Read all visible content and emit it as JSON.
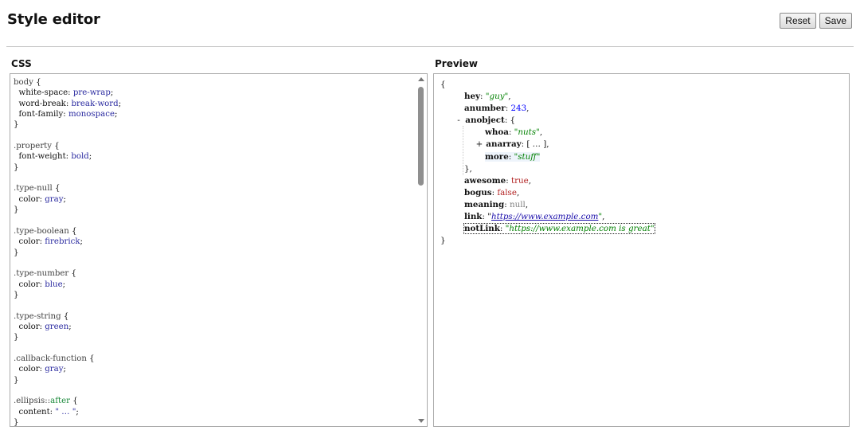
{
  "header": {
    "title": "Style editor",
    "reset_label": "Reset",
    "save_label": "Save"
  },
  "css_panel": {
    "label": "CSS",
    "lines": [
      [
        [
          "sel",
          "body"
        ],
        [
          "plain",
          " {"
        ]
      ],
      [
        [
          "plain",
          "  "
        ],
        [
          "prop",
          "white-space"
        ],
        [
          "plain",
          ": "
        ],
        [
          "val",
          "pre-wrap"
        ],
        [
          "plain",
          ";"
        ]
      ],
      [
        [
          "plain",
          "  "
        ],
        [
          "prop",
          "word-break"
        ],
        [
          "plain",
          ": "
        ],
        [
          "val",
          "break-word"
        ],
        [
          "plain",
          ";"
        ]
      ],
      [
        [
          "plain",
          "  "
        ],
        [
          "prop",
          "font-family"
        ],
        [
          "plain",
          ": "
        ],
        [
          "val",
          "monospace"
        ],
        [
          "plain",
          ";"
        ]
      ],
      [
        [
          "plain",
          "}"
        ]
      ],
      [
        [
          "plain",
          ""
        ]
      ],
      [
        [
          "sel",
          ".property"
        ],
        [
          "plain",
          " {"
        ]
      ],
      [
        [
          "plain",
          "  "
        ],
        [
          "prop",
          "font-weight"
        ],
        [
          "plain",
          ": "
        ],
        [
          "val",
          "bold"
        ],
        [
          "plain",
          ";"
        ]
      ],
      [
        [
          "plain",
          "}"
        ]
      ],
      [
        [
          "plain",
          ""
        ]
      ],
      [
        [
          "sel",
          ".type-null"
        ],
        [
          "plain",
          " {"
        ]
      ],
      [
        [
          "plain",
          "  "
        ],
        [
          "prop",
          "color"
        ],
        [
          "plain",
          ": "
        ],
        [
          "val",
          "gray"
        ],
        [
          "plain",
          ";"
        ]
      ],
      [
        [
          "plain",
          "}"
        ]
      ],
      [
        [
          "plain",
          ""
        ]
      ],
      [
        [
          "sel",
          ".type-boolean"
        ],
        [
          "plain",
          " {"
        ]
      ],
      [
        [
          "plain",
          "  "
        ],
        [
          "prop",
          "color"
        ],
        [
          "plain",
          ": "
        ],
        [
          "val",
          "firebrick"
        ],
        [
          "plain",
          ";"
        ]
      ],
      [
        [
          "plain",
          "}"
        ]
      ],
      [
        [
          "plain",
          ""
        ]
      ],
      [
        [
          "sel",
          ".type-number"
        ],
        [
          "plain",
          " {"
        ]
      ],
      [
        [
          "plain",
          "  "
        ],
        [
          "prop",
          "color"
        ],
        [
          "plain",
          ": "
        ],
        [
          "val",
          "blue"
        ],
        [
          "plain",
          ";"
        ]
      ],
      [
        [
          "plain",
          "}"
        ]
      ],
      [
        [
          "plain",
          ""
        ]
      ],
      [
        [
          "sel",
          ".type-string"
        ],
        [
          "plain",
          " {"
        ]
      ],
      [
        [
          "plain",
          "  "
        ],
        [
          "prop",
          "color"
        ],
        [
          "plain",
          ": "
        ],
        [
          "val",
          "green"
        ],
        [
          "plain",
          ";"
        ]
      ],
      [
        [
          "plain",
          "}"
        ]
      ],
      [
        [
          "plain",
          ""
        ]
      ],
      [
        [
          "sel",
          ".callback-function"
        ],
        [
          "plain",
          " {"
        ]
      ],
      [
        [
          "plain",
          "  "
        ],
        [
          "prop",
          "color"
        ],
        [
          "plain",
          ": "
        ],
        [
          "val",
          "gray"
        ],
        [
          "plain",
          ";"
        ]
      ],
      [
        [
          "plain",
          "}"
        ]
      ],
      [
        [
          "plain",
          ""
        ]
      ],
      [
        [
          "sel",
          ".ellipsis::"
        ],
        [
          "ps",
          "after"
        ],
        [
          "plain",
          " {"
        ]
      ],
      [
        [
          "plain",
          "  "
        ],
        [
          "prop",
          "content"
        ],
        [
          "plain",
          ": "
        ],
        [
          "val",
          "\" … \""
        ],
        [
          "plain",
          ";"
        ]
      ],
      [
        [
          "plain",
          "}"
        ]
      ]
    ]
  },
  "preview_panel": {
    "label": "Preview",
    "rows": [
      {
        "indent": 0,
        "toggle": "",
        "parts": [
          [
            "plain",
            "{"
          ]
        ]
      },
      {
        "indent": 1,
        "toggle": "",
        "parts": [
          [
            "k",
            "hey"
          ],
          [
            "plain",
            ": "
          ],
          [
            "str",
            "\"guy\""
          ],
          [
            "plain",
            ","
          ]
        ]
      },
      {
        "indent": 1,
        "toggle": "",
        "parts": [
          [
            "k",
            "anumber"
          ],
          [
            "plain",
            ": "
          ],
          [
            "num",
            "243"
          ],
          [
            "plain",
            ","
          ]
        ]
      },
      {
        "indent": 1,
        "toggle": "-",
        "parts": [
          [
            "k",
            "anobject"
          ],
          [
            "plain",
            ": {"
          ]
        ]
      },
      {
        "indent": 2,
        "toggle": "",
        "parts": [
          [
            "k",
            "whoa"
          ],
          [
            "plain",
            ": "
          ],
          [
            "str",
            "\"nuts\""
          ],
          [
            "plain",
            ","
          ]
        ]
      },
      {
        "indent": 2,
        "toggle": "+",
        "parts": [
          [
            "k",
            "anarray"
          ],
          [
            "plain",
            ": [ … ],"
          ]
        ]
      },
      {
        "indent": 2,
        "toggle": "",
        "parts": [
          [
            "k",
            "more"
          ],
          [
            "plain",
            ": "
          ],
          [
            "str",
            "\"stuff\""
          ]
        ],
        "highlight": true
      },
      {
        "indent": 1,
        "toggle": "",
        "parts": [
          [
            "plain",
            "},"
          ]
        ]
      },
      {
        "indent": 1,
        "toggle": "",
        "parts": [
          [
            "k",
            "awesome"
          ],
          [
            "plain",
            ": "
          ],
          [
            "bool",
            "true"
          ],
          [
            "plain",
            ","
          ]
        ]
      },
      {
        "indent": 1,
        "toggle": "",
        "parts": [
          [
            "k",
            "bogus"
          ],
          [
            "plain",
            ": "
          ],
          [
            "bool",
            "false"
          ],
          [
            "plain",
            ","
          ]
        ]
      },
      {
        "indent": 1,
        "toggle": "",
        "parts": [
          [
            "k",
            "meaning"
          ],
          [
            "plain",
            ": "
          ],
          [
            "nul",
            "null"
          ],
          [
            "plain",
            ","
          ]
        ]
      },
      {
        "indent": 1,
        "toggle": "",
        "parts": [
          [
            "k",
            "link"
          ],
          [
            "plain",
            ": \""
          ],
          [
            "lnk",
            "https://www.example.com"
          ],
          [
            "str",
            "\""
          ],
          [
            "plain",
            ","
          ]
        ]
      },
      {
        "indent": 1,
        "toggle": "",
        "parts": [
          [
            "k",
            "notLink"
          ],
          [
            "plain",
            ": "
          ],
          [
            "str",
            "\"https://www.example.com is great\""
          ]
        ],
        "focus": true
      },
      {
        "indent": 0,
        "toggle": "",
        "parts": [
          [
            "plain",
            "}"
          ]
        ]
      }
    ]
  },
  "colors": {
    "string": "green",
    "number": "blue",
    "boolean": "firebrick",
    "null": "gray",
    "link": "#1a0dab"
  }
}
